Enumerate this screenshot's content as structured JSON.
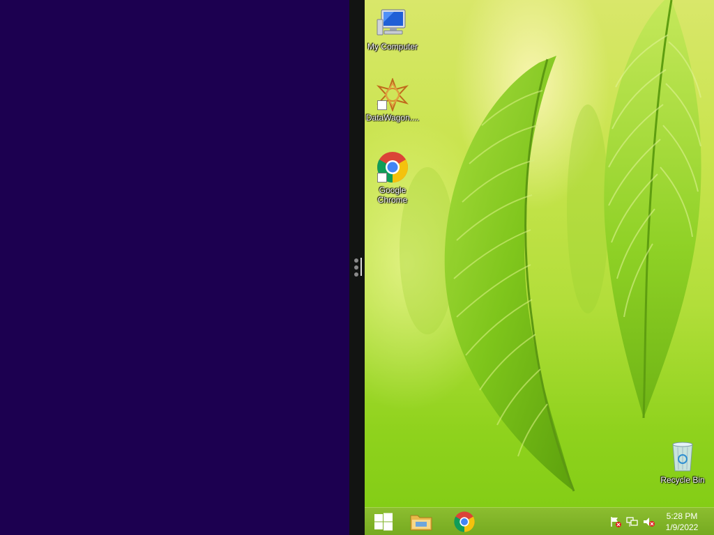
{
  "desktop": {
    "icons": [
      {
        "label": "My Computer",
        "icon": "computer-icon"
      },
      {
        "label": "DataWagon....",
        "icon": "datawagon-icon"
      },
      {
        "label": "Google Chrome",
        "icon": "chrome-icon"
      },
      {
        "label": "Recycle Bin",
        "icon": "recycle-bin-icon"
      }
    ]
  },
  "taskbar": {
    "pinned": [
      {
        "name": "Start",
        "icon": "windows-logo-icon"
      },
      {
        "name": "File Explorer",
        "icon": "folder-icon"
      },
      {
        "name": "Google Chrome",
        "icon": "chrome-icon"
      }
    ],
    "tray": {
      "icons": [
        "action-center-flag-icon",
        "network-icon",
        "speaker-muted-icon"
      ]
    },
    "clock": {
      "time": "5:28 PM",
      "date": "1/9/2022"
    }
  },
  "colors": {
    "snap_pane": "#1c0050",
    "divider": "#121412",
    "taskbar": "#7fb21e"
  }
}
